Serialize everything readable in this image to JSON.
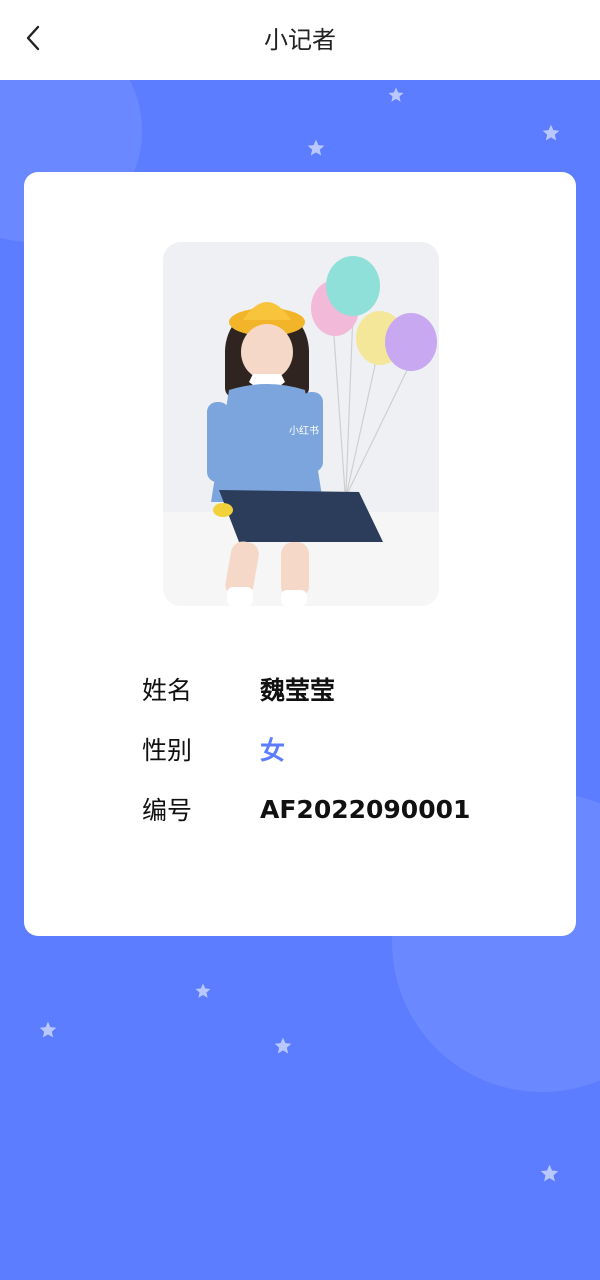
{
  "header": {
    "title": "小记者",
    "back_icon": "chevron-left-icon"
  },
  "profile": {
    "photo": "student-photo",
    "fields": [
      {
        "label": "姓名",
        "value": "魏莹莹"
      },
      {
        "label": "性别",
        "value": "女"
      },
      {
        "label": "编号",
        "value": "AF2022090001"
      }
    ]
  },
  "colors": {
    "background": "#5c7dff",
    "card": "#ffffff",
    "accent": "#5c7dff",
    "star": "#b9c8ff"
  }
}
